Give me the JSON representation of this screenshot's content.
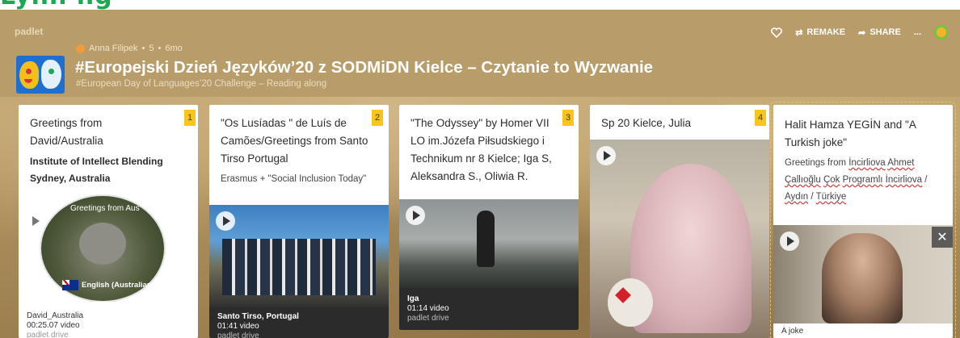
{
  "header": {
    "brand": "padlet",
    "author": "Anna Filipek",
    "likes": "5",
    "age": "6mo",
    "title": "#Europejski Dzień Języków’20 z SODMiDN Kielce – Czytanie to Wyzwanie",
    "subtitle": "#European Day of Languages’20 Challenge – Reading along",
    "actions": {
      "remake": "REMAKE",
      "share": "SHARE",
      "more": "..."
    }
  },
  "cards": [
    {
      "number": "1",
      "heading": "Greetings from David/Australia",
      "body": "Institute of Intellect Blending Sydney, Australia",
      "thumb_overlay_top": "Greetings from Aus",
      "thumb_overlay_badge": "English (Australian)",
      "caption": [
        "David_Australia",
        "00:25.07 video",
        "padlet drive"
      ]
    },
    {
      "number": "2",
      "heading": "\"Os Lusíadas \" de Luís de Camões/Greetings from Santo Tirso Portugal",
      "body": "Erasmus + \"Social Inclusion Today\"",
      "caption": [
        "Santo Tirso, Portugal",
        "01:41 video",
        "padlet drive"
      ]
    },
    {
      "number": "3",
      "heading": "\"The Odyssey\" by Homer VII LO im.Józefa Piłsudskiego i Technikum nr 8 Kielce; Iga S, Aleksandra S., Oliwia R.",
      "caption": [
        "Iga",
        "01:14 video",
        "padlet drive"
      ]
    },
    {
      "number": "4",
      "heading": "Sp 20 Kielce, Julia"
    },
    {
      "heading": "Halit Hamza YEGİN and \"A Turkish joke\"",
      "body_parts": [
        "Greetings from ",
        "İncirliova",
        " ",
        "Ahmet",
        " ",
        "Çallıoğlu",
        " ",
        "Çok",
        " ",
        "Programlı",
        " ",
        "İncirliova",
        " / ",
        "Aydın",
        " / ",
        "Türkiye"
      ],
      "caption": [
        "A joke"
      ]
    }
  ],
  "colors": {
    "board": "#b89c69",
    "number_badge": "#f7c51c",
    "accent_green": "#1aa851"
  },
  "icons": [
    "heart-icon",
    "remake-icon",
    "share-icon",
    "more-icon",
    "padlet-logo-icon",
    "play-icon",
    "close-icon"
  ]
}
